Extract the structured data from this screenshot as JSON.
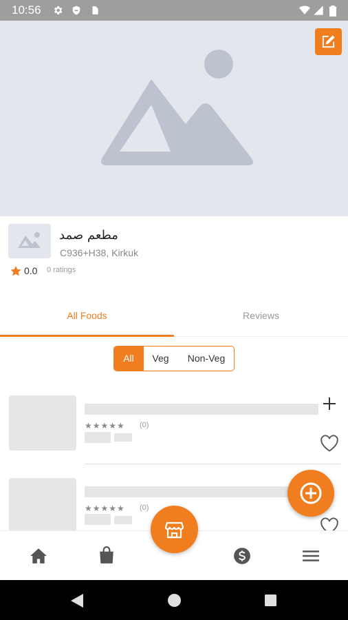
{
  "status_bar": {
    "time": "10:56"
  },
  "restaurant": {
    "name": "مطعم صمد",
    "address": "C936+H38, Kirkuk",
    "rating": "0.0",
    "ratings_count": "0 ratings"
  },
  "tabs": [
    {
      "label": "All Foods"
    },
    {
      "label": "Reviews"
    }
  ],
  "filters": [
    {
      "label": "All"
    },
    {
      "label": "Veg"
    },
    {
      "label": "Non-Veg"
    }
  ],
  "food_items": [
    {
      "stars": "★★★★★",
      "count": "(0)"
    },
    {
      "stars": "★★★★★",
      "count": "(0)"
    }
  ],
  "colors": {
    "accent": "#f07e1f",
    "status_bar": "#9e9e9e",
    "placeholder": "#e4e6ee"
  },
  "icons": {
    "status": [
      "gear-icon",
      "shield-icon",
      "sim-card-icon",
      "wifi-icon",
      "signal-icon",
      "battery-icon"
    ],
    "bottom_nav": [
      "home-icon",
      "shopping-bag-icon",
      "store-icon",
      "dollar-icon",
      "menu-icon"
    ]
  }
}
